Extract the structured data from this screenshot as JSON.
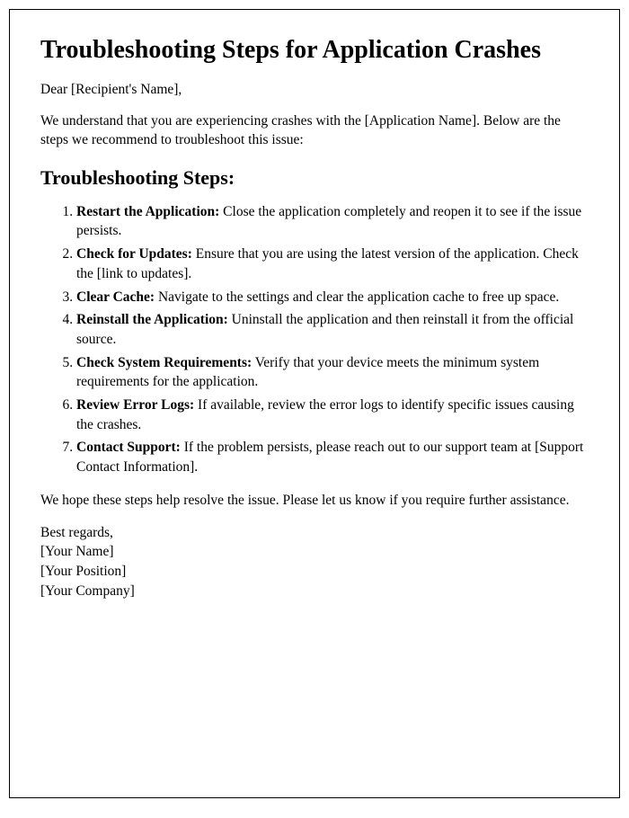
{
  "title": "Troubleshooting Steps for Application Crashes",
  "greeting": "Dear [Recipient's Name],",
  "intro": "We understand that you are experiencing crashes with the [Application Name]. Below are the steps we recommend to troubleshoot this issue:",
  "section_heading": "Troubleshooting Steps:",
  "steps": [
    {
      "title": "Restart the Application:",
      "body": " Close the application completely and reopen it to see if the issue persists."
    },
    {
      "title": "Check for Updates:",
      "body": " Ensure that you are using the latest version of the application. Check the [link to updates]."
    },
    {
      "title": "Clear Cache:",
      "body": " Navigate to the settings and clear the application cache to free up space."
    },
    {
      "title": "Reinstall the Application:",
      "body": " Uninstall the application and then reinstall it from the official source."
    },
    {
      "title": "Check System Requirements:",
      "body": " Verify that your device meets the minimum system requirements for the application."
    },
    {
      "title": "Review Error Logs:",
      "body": " If available, review the error logs to identify specific issues causing the crashes."
    },
    {
      "title": "Contact Support:",
      "body": " If the problem persists, please reach out to our support team at [Support Contact Information]."
    }
  ],
  "outro": "We hope these steps help resolve the issue. Please let us know if you require further assistance.",
  "closing": "Best regards,",
  "name": "[Your Name]",
  "position": "[Your Position]",
  "company": "[Your Company]"
}
